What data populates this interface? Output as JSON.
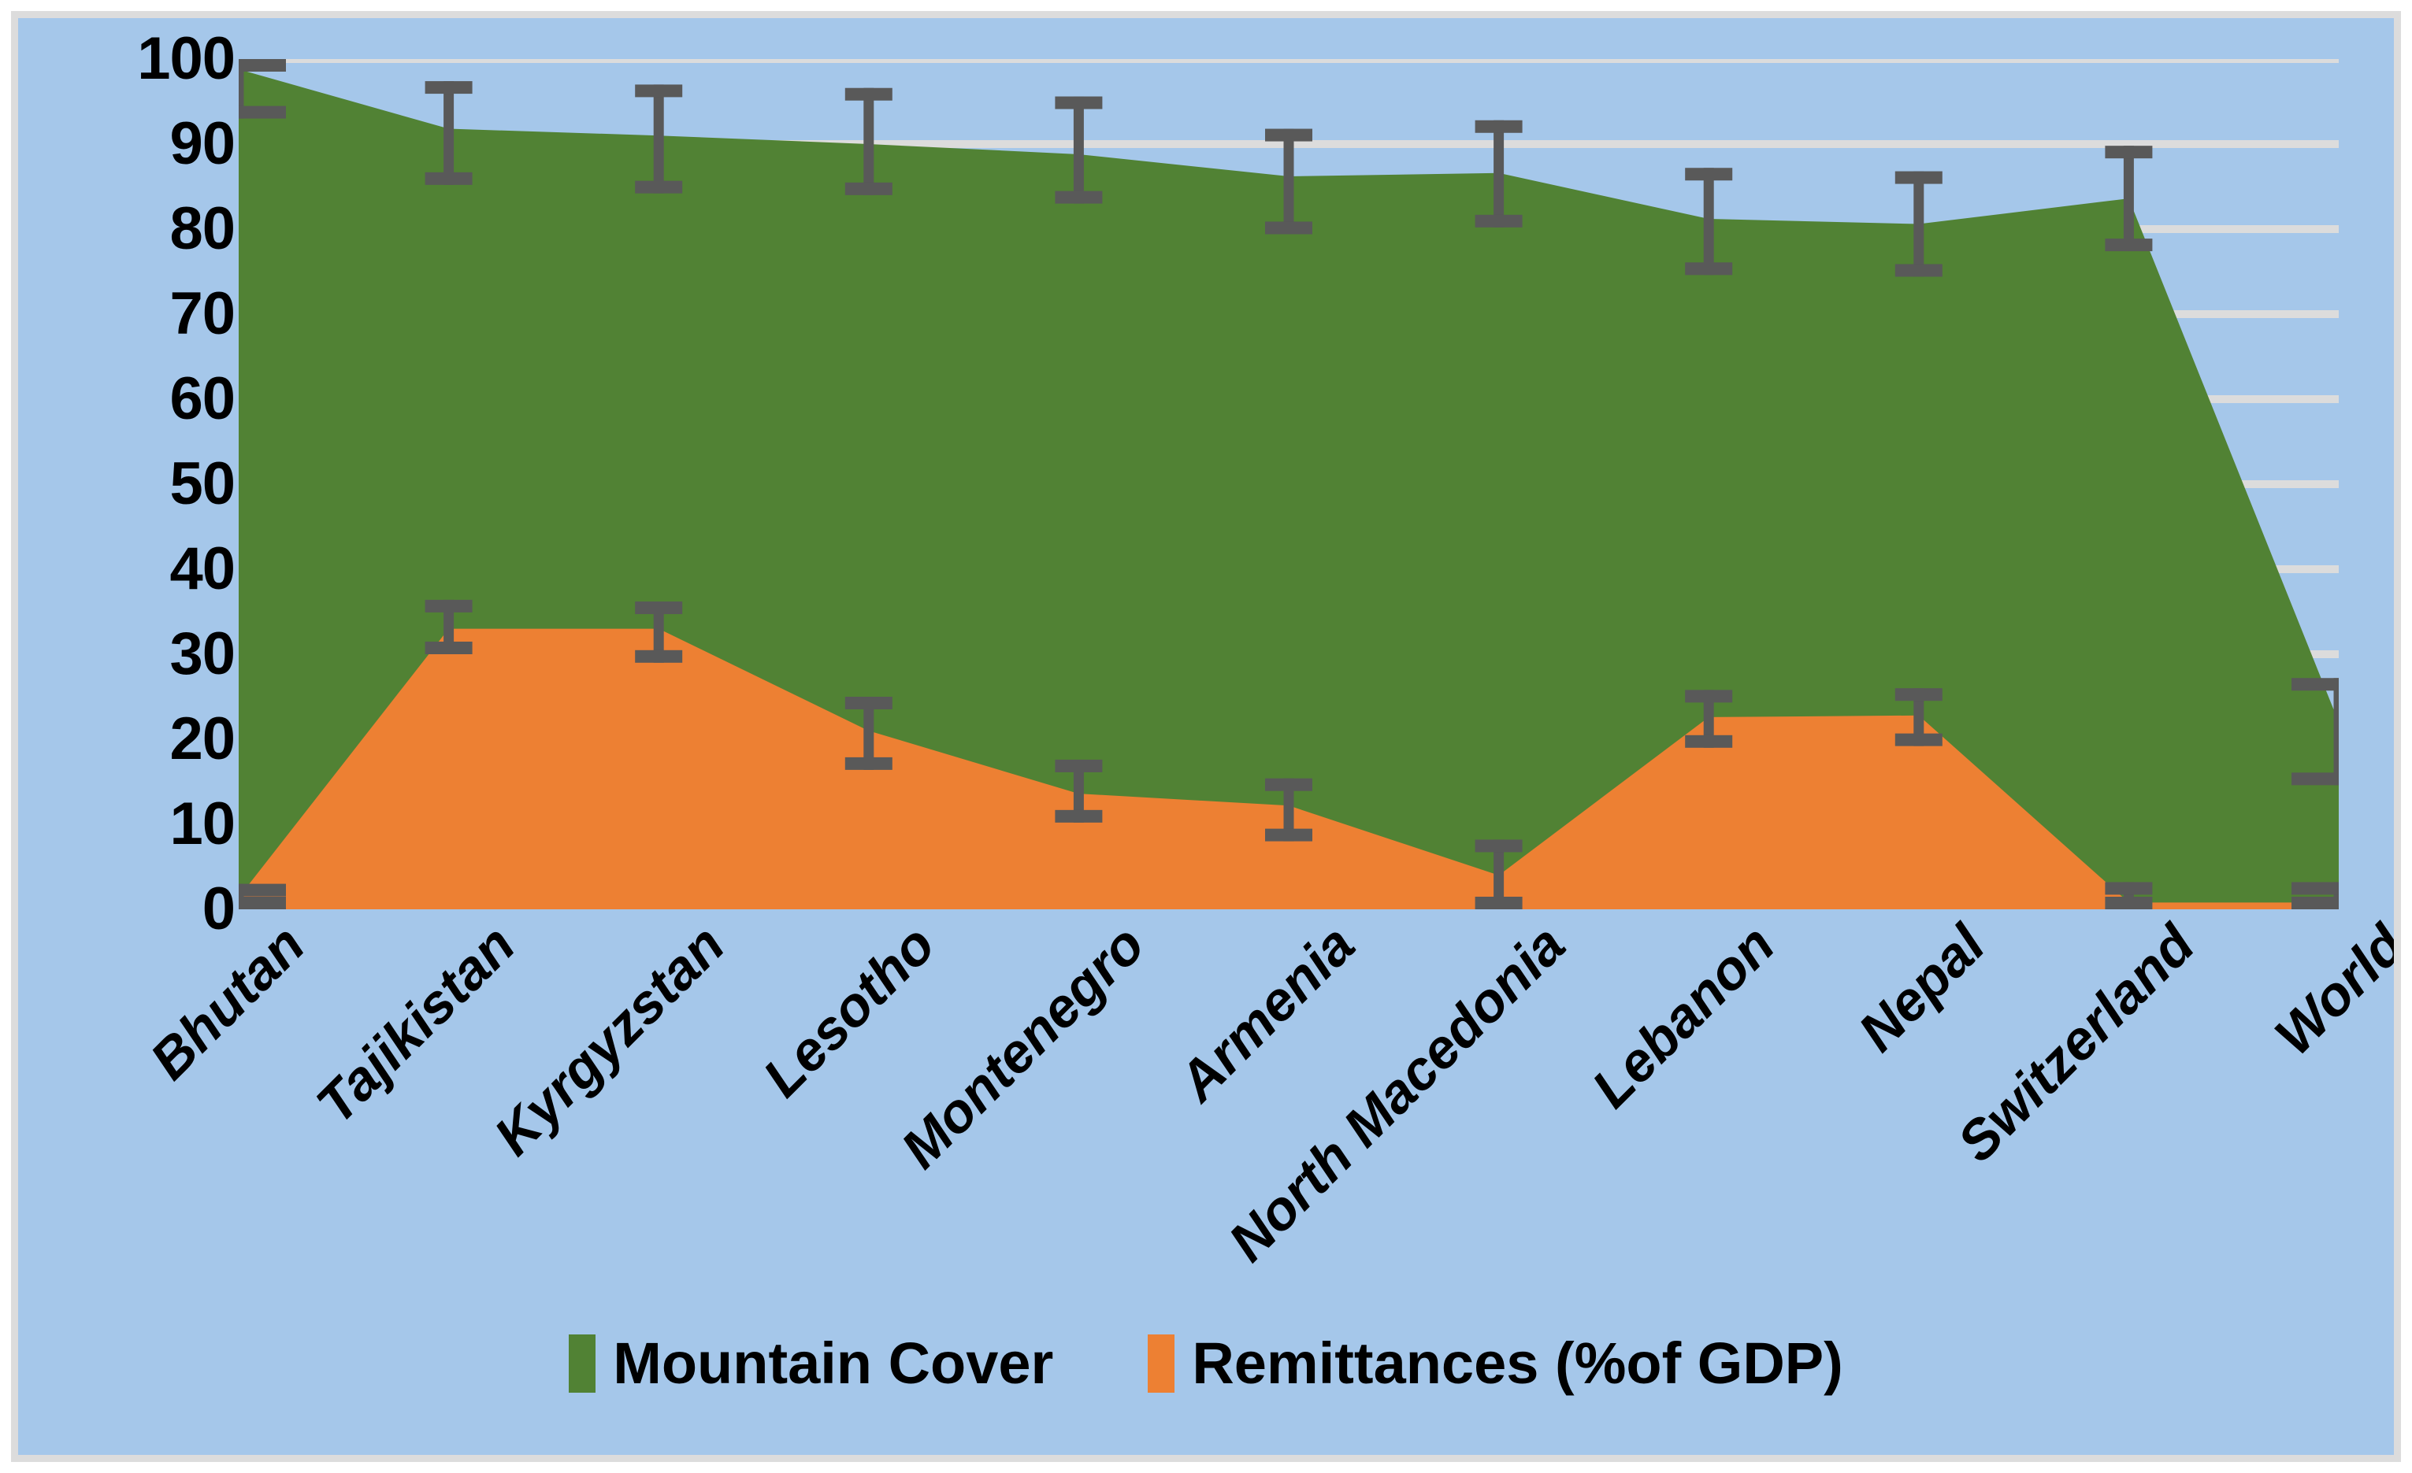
{
  "chart_data": {
    "type": "area",
    "title": "",
    "subtitle": "",
    "xlabel": "",
    "ylabel": "",
    "ylim": [
      0,
      100
    ],
    "yticks": [
      100,
      90,
      80,
      70,
      60,
      50,
      40,
      30,
      20,
      10,
      0
    ],
    "grid": true,
    "legend_position": "bottom",
    "categories": [
      "Bhutan",
      "Tajikistan",
      "Kyrgyzstan",
      "Lesotho",
      "Montenegro",
      "Armenia",
      "North Macedonia",
      "Lebanon",
      "Nepal",
      "Switzerland",
      "World"
    ],
    "series": [
      {
        "name": "Mountain Cover",
        "color": "#518234",
        "values": [
          98.8,
          91.8,
          91.0,
          90.0,
          88.8,
          86.2,
          86.6,
          81.2,
          80.6,
          83.6,
          22.0
        ],
        "error_low": [
          93.0,
          85.2,
          84.2,
          84.0,
          83.0,
          79.4,
          80.2,
          74.6,
          74.4,
          77.4,
          14.6
        ],
        "error_high": [
          100.0,
          97.4,
          97.0,
          96.6,
          95.6,
          91.8,
          92.8,
          87.2,
          86.8,
          89.8,
          27.2
        ]
      },
      {
        "name": "Remittances (%of GDP)",
        "color": "#ed8033",
        "values": [
          1.4,
          33.0,
          33.0,
          21.0,
          13.6,
          12.2,
          4.0,
          22.6,
          22.8,
          0.8,
          0.8
        ],
        "error_low": [
          0.0,
          30.0,
          29.0,
          16.4,
          10.2,
          8.0,
          0.0,
          19.0,
          19.2,
          0.0,
          0.0
        ],
        "error_high": [
          3.0,
          36.4,
          36.2,
          25.0,
          17.6,
          15.4,
          8.2,
          25.8,
          26.0,
          3.2,
          3.2
        ]
      }
    ],
    "legend": [
      {
        "label": "Mountain Cover",
        "color": "#518234"
      },
      {
        "label": "Remittances (%of GDP)",
        "color": "#ed8033"
      }
    ]
  },
  "style": {
    "background": "#a5c7ea",
    "frame_border": "#dcdcdc",
    "gridline": "#dcdcdc",
    "errorbar": "#595959",
    "tick_text": "#000000"
  }
}
